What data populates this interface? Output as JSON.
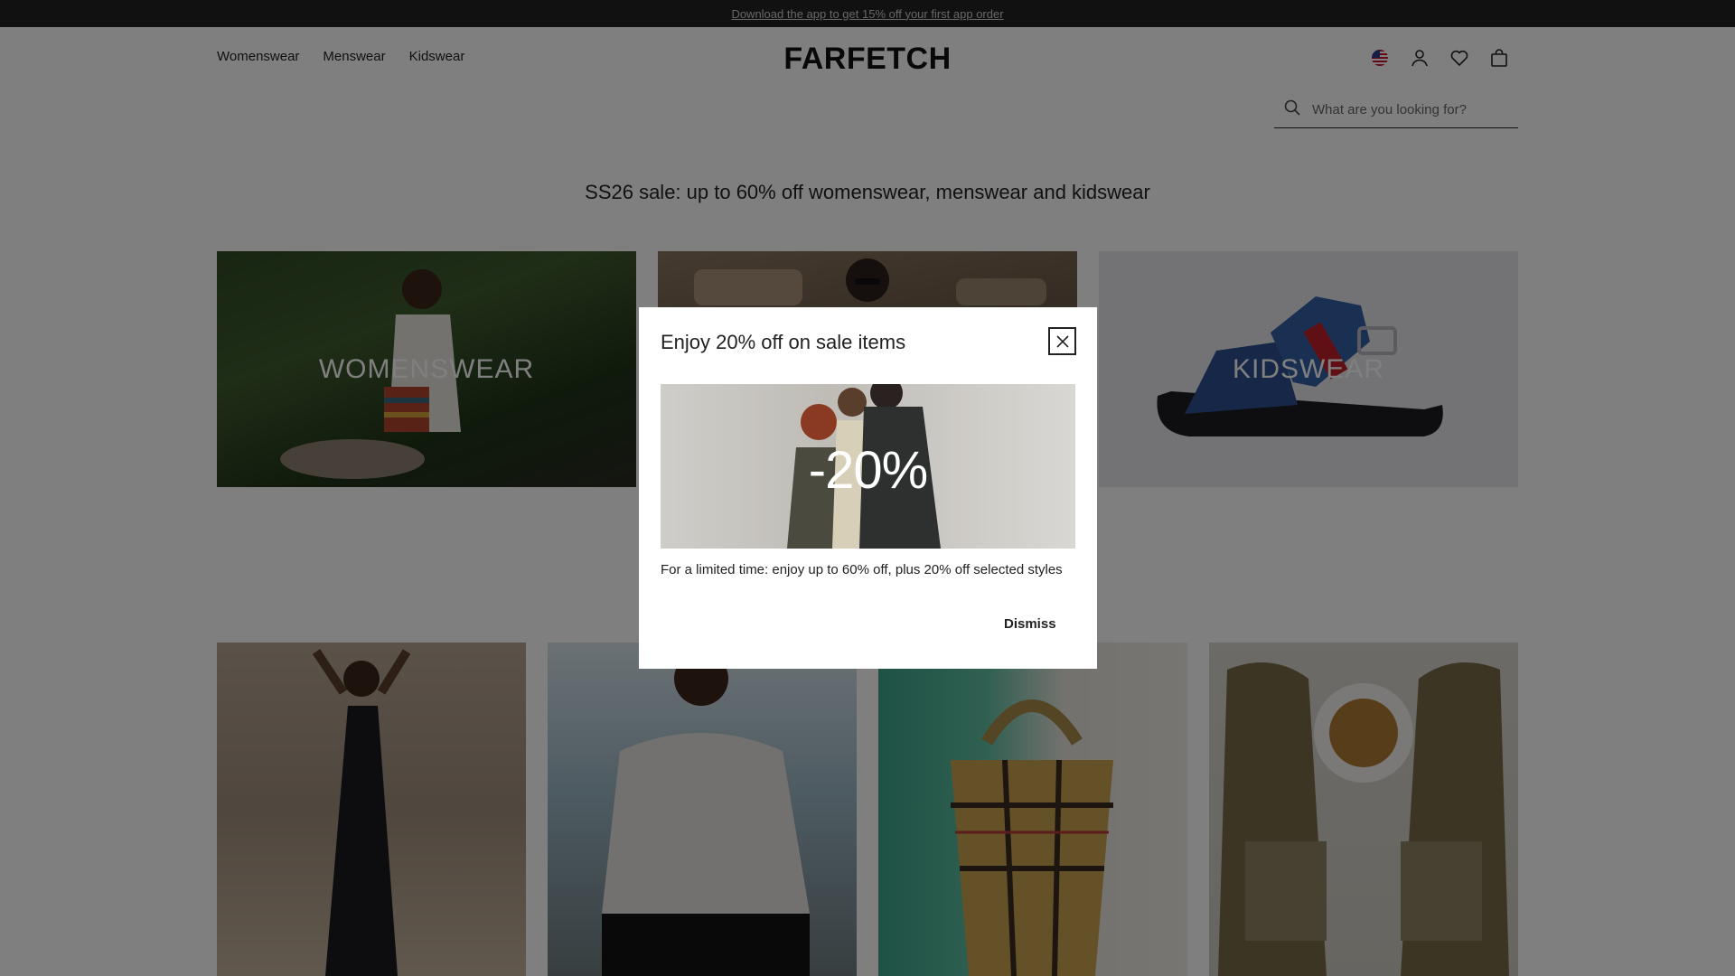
{
  "promo_bar": {
    "text": "Download the app to get 15% off your first app order"
  },
  "header": {
    "nav": [
      "Womenswear",
      "Menswear",
      "Kidswear"
    ],
    "logo": "FARFETCH",
    "search_placeholder": "What are you looking for?",
    "icons": [
      "us-flag-icon",
      "account-icon",
      "wishlist-heart-icon",
      "bag-icon"
    ]
  },
  "sale_title": "SS26 sale: up to 60% off womenswear, menswear and kidswear",
  "categories": [
    {
      "label": "WOMENSWEAR"
    },
    {
      "label": ""
    },
    {
      "label": "KIDSWEAR"
    }
  ],
  "modal": {
    "title": "Enjoy 20% off on sale items",
    "image_text": "-20%",
    "body": "For a limited time: enjoy up to 60% off, plus 20% off selected styles",
    "dismiss_label": "Dismiss"
  },
  "colors": {
    "promo_bg": "#222222",
    "overlay": "rgba(0,0,0,0.5)"
  }
}
